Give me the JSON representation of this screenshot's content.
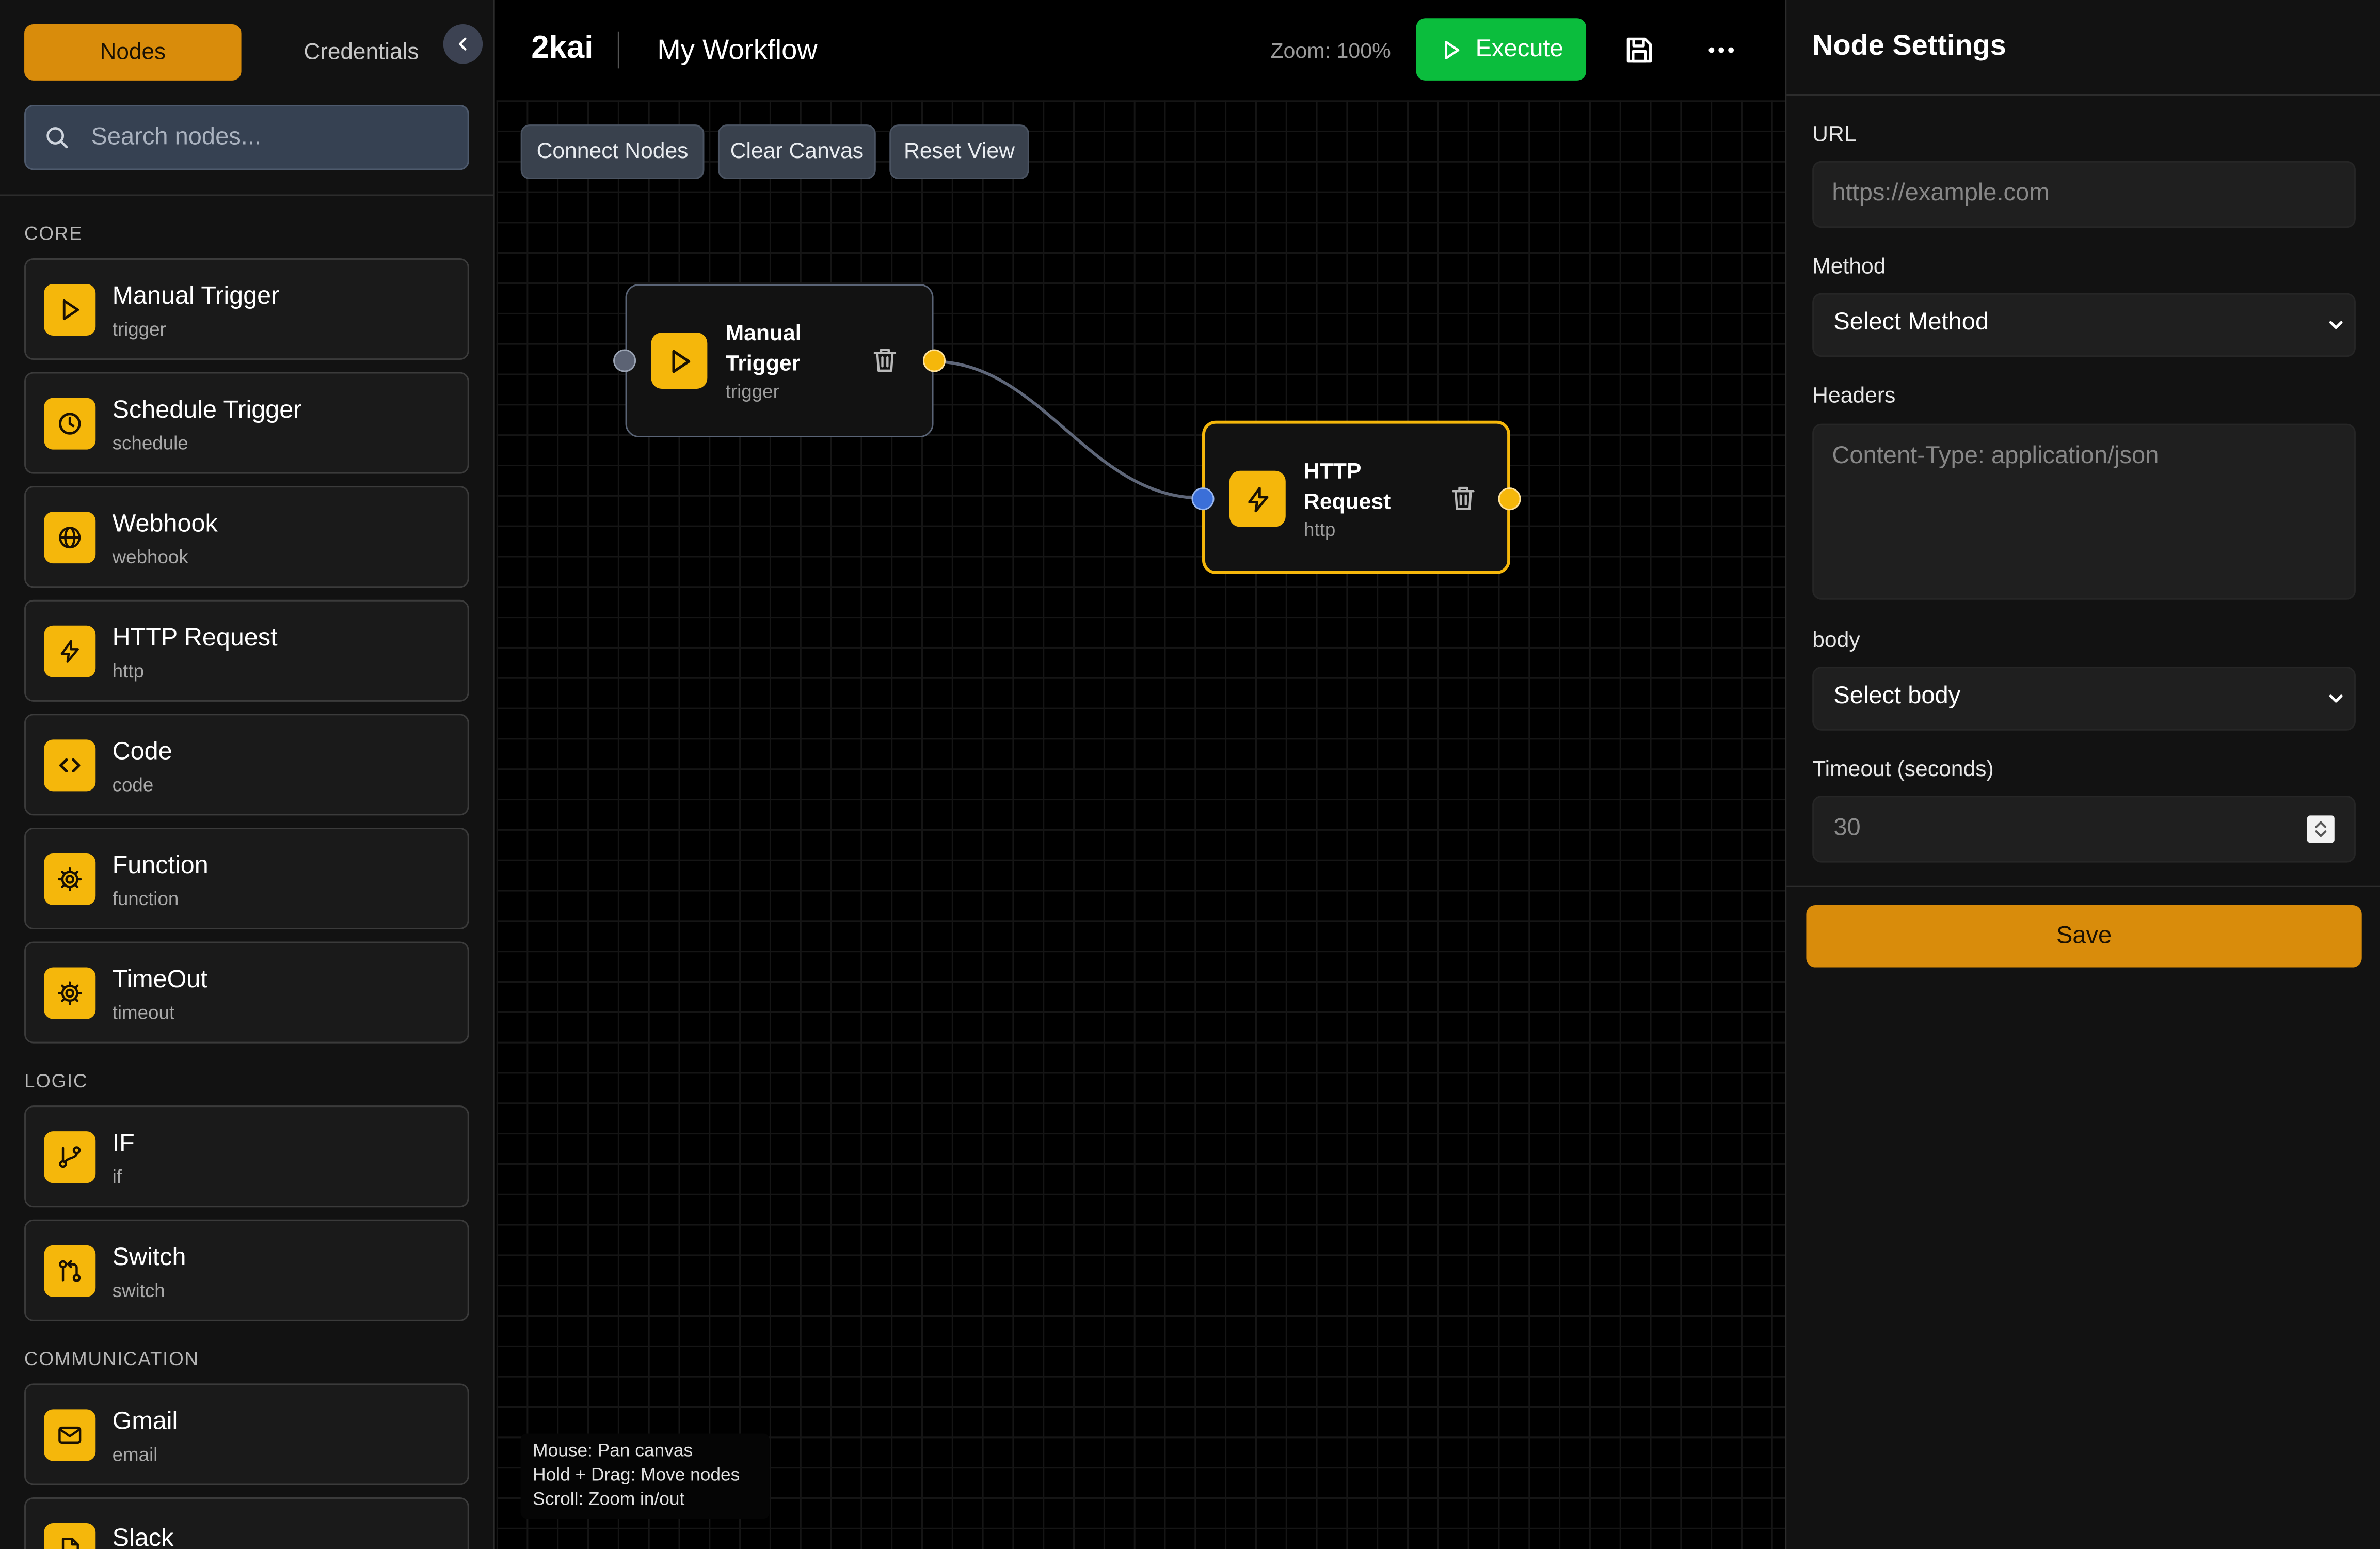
{
  "sidebar": {
    "tabs": {
      "nodes": "Nodes",
      "credentials": "Credentials"
    },
    "search": {
      "placeholder": "Search nodes..."
    },
    "sections": [
      {
        "label": "CORE",
        "items": [
          {
            "title": "Manual Trigger",
            "subtitle": "trigger",
            "icon": "play-icon"
          },
          {
            "title": "Schedule Trigger",
            "subtitle": "schedule",
            "icon": "clock-icon"
          },
          {
            "title": "Webhook",
            "subtitle": "webhook",
            "icon": "globe-icon"
          },
          {
            "title": "HTTP Request",
            "subtitle": "http",
            "icon": "lightning-icon"
          },
          {
            "title": "Code",
            "subtitle": "code",
            "icon": "code-icon"
          },
          {
            "title": "Function",
            "subtitle": "function",
            "icon": "gear-icon"
          },
          {
            "title": "TimeOut",
            "subtitle": "timeout",
            "icon": "gear-icon"
          }
        ]
      },
      {
        "label": "LOGIC",
        "items": [
          {
            "title": "IF",
            "subtitle": "if",
            "icon": "branch-icon"
          },
          {
            "title": "Switch",
            "subtitle": "switch",
            "icon": "pull-request-icon"
          }
        ]
      },
      {
        "label": "COMMUNICATION",
        "items": [
          {
            "title": "Gmail",
            "subtitle": "email",
            "icon": "mail-icon"
          },
          {
            "title": "Slack",
            "subtitle": "",
            "icon": "file-icon"
          }
        ]
      }
    ]
  },
  "header": {
    "app_name": "2kai",
    "workflow_name": "My Workflow",
    "zoom_label": "Zoom: 100%",
    "execute_label": "Execute"
  },
  "toolbar": {
    "connect_label": "Connect Nodes",
    "clear_label": "Clear Canvas",
    "reset_label": "Reset View"
  },
  "canvas": {
    "nodes": [
      {
        "title": "Manual Trigger",
        "subtitle": "trigger",
        "icon": "play-icon",
        "selected": false
      },
      {
        "title": "HTTP Request",
        "subtitle": "http",
        "icon": "lightning-icon",
        "selected": true
      }
    ],
    "help": [
      "Mouse: Pan canvas",
      "Hold + Drag: Move nodes",
      "Scroll: Zoom in/out"
    ]
  },
  "settings": {
    "title": "Node Settings",
    "url": {
      "label": "URL",
      "placeholder": "https://example.com"
    },
    "method": {
      "label": "Method",
      "value": "Select Method"
    },
    "headers": {
      "label": "Headers",
      "placeholder": "Content-Type: application/json"
    },
    "body": {
      "label": "body",
      "value": "Select body"
    },
    "timeout": {
      "label": "Timeout (seconds)",
      "value": "30"
    },
    "save_label": "Save"
  },
  "colors": {
    "accent": "#f5b70b",
    "tab_active": "#d98c0b",
    "execute": "#0bbd3d",
    "background": "#000000",
    "panel": "#121212"
  }
}
